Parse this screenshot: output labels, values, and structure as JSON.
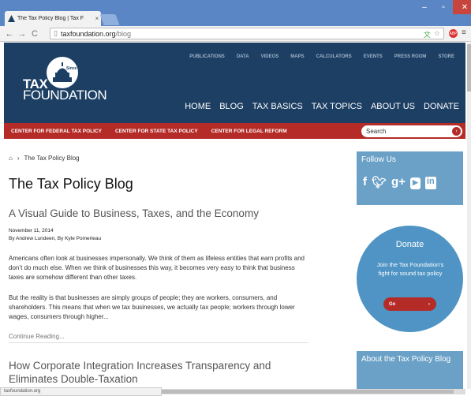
{
  "browser": {
    "tab_title": "The Tax Policy Blog | Tax F",
    "tab_close": "×",
    "url_host": "taxfoundation.org",
    "url_path": "/blog",
    "status_url": "taxfoundation.org"
  },
  "site": {
    "logo_since": "Since 1937",
    "logo_tax": "TAX",
    "logo_foundation": "FOUNDATION",
    "top_links": [
      "PUBLICATIONS",
      "DATA",
      "VIDEOS",
      "MAPS",
      "CALCULATORS",
      "EVENTS",
      "PRESS ROOM",
      "STORE"
    ],
    "main_nav": [
      "HOME",
      "BLOG",
      "TAX BASICS",
      "TAX TOPICS",
      "ABOUT US",
      "DONATE"
    ],
    "sub_nav": [
      "CENTER FOR FEDERAL TAX POLICY",
      "CENTER FOR STATE TAX POLICY",
      "CENTER FOR LEGAL REFORM"
    ],
    "search_placeholder": "Search"
  },
  "content": {
    "breadcrumb": "The Tax Policy Blog",
    "page_title": "The Tax Policy Blog",
    "post1": {
      "title": "A Visual Guide to Business, Taxes, and the Economy",
      "date": "November 11, 2014",
      "authors": "By Andrew Lundeen, By Kyle Pomerleau",
      "p1": "Americans often look at businesses impersonally. We think of them as lifeless entities that earn profits and don’t do much else. When we think of businesses this way, it becomes very easy to think that business taxes are somehow different than other taxes.",
      "p2": "But the reality is that businesses are simply groups of people; they are workers, consumers, and shareholders. This means that when we tax businesses, we actually tax people; workers through lower wages, consumers through higher...",
      "continue": "Continue Reading..."
    },
    "post2": {
      "title": "How Corporate Integration Increases Transparency and Eliminates Double-Taxation"
    }
  },
  "sidebar": {
    "follow_label": "Follow Us",
    "social_icons": [
      "facebook-icon",
      "twitter-icon",
      "google-plus-icon",
      "youtube-icon",
      "linkedin-icon"
    ],
    "donate_title": "Donate",
    "donate_text": "Join the Tax Foundation's fight for sound tax policy",
    "donate_go": "Go",
    "about_label": "About the Tax Policy Blog"
  },
  "colors": {
    "header_bg": "#1c3f63",
    "subnav_bg": "#b42b27",
    "sidebar_bg": "#6ba1c7",
    "donate_bg": "#4f94c4"
  }
}
